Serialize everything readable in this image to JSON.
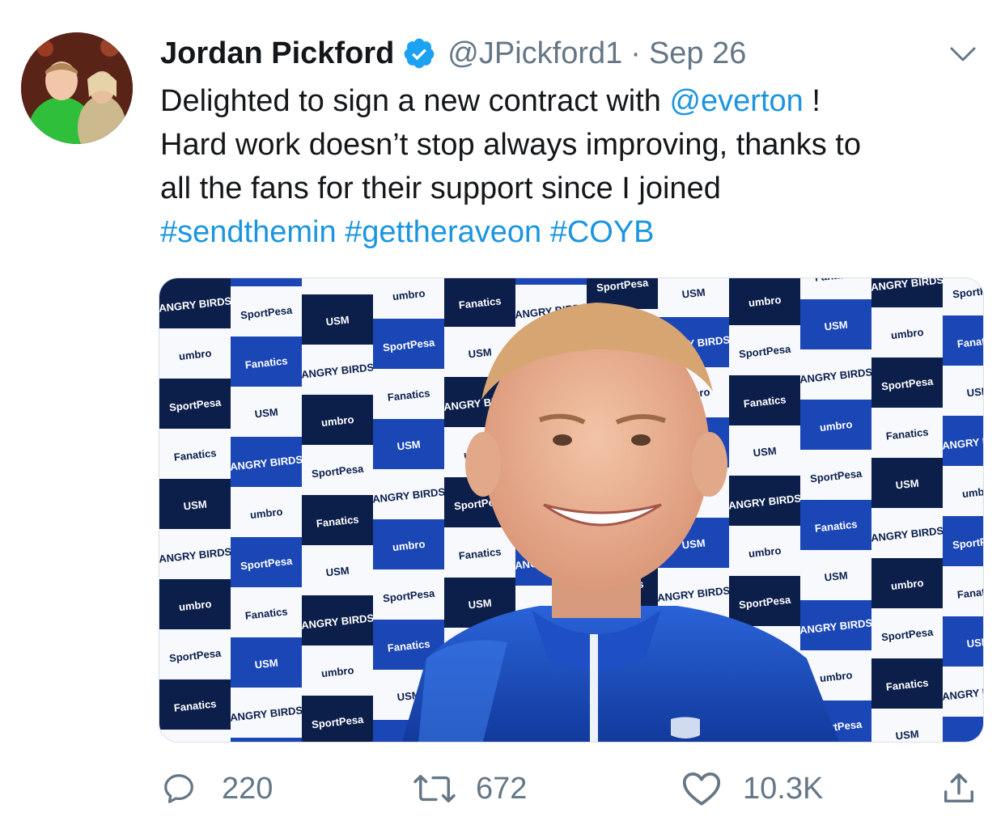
{
  "tweet": {
    "author_name": "Jordan Pickford",
    "handle": "@JPickford1",
    "separator": "·",
    "date": "Sep 26",
    "text": {
      "line1_prefix": "Delighted to sign a new contract with ",
      "mention": "@everton",
      "line1_suffix": " !",
      "line2": "Hard work doesn’t stop always improving, thanks to",
      "line3": "all the fans for their support since I joined",
      "hashtags": [
        "#sendthemin",
        "#gettheraveon",
        "#COYB"
      ]
    }
  },
  "media": {
    "board_text": {
      "angry_birds": "ANGRY BIRDS",
      "sportpesa": "SportPesa",
      "usm": "USM",
      "umbro": "umbro",
      "fanatics": "Fanatics"
    }
  },
  "actions": {
    "reply_count": "220",
    "retweet_count": "672",
    "like_count": "10.3K"
  },
  "colors": {
    "link": "#1b95e0",
    "secondary_text": "#657786",
    "everton_blue": "#1a46b6",
    "board_navy": "#0c1f4a",
    "verified": "#1da1f2"
  },
  "icons": {
    "verified": "verified-badge-icon",
    "caret": "chevron-down-icon",
    "reply": "reply-icon",
    "retweet": "retweet-icon",
    "like": "heart-icon",
    "share": "share-icon"
  }
}
